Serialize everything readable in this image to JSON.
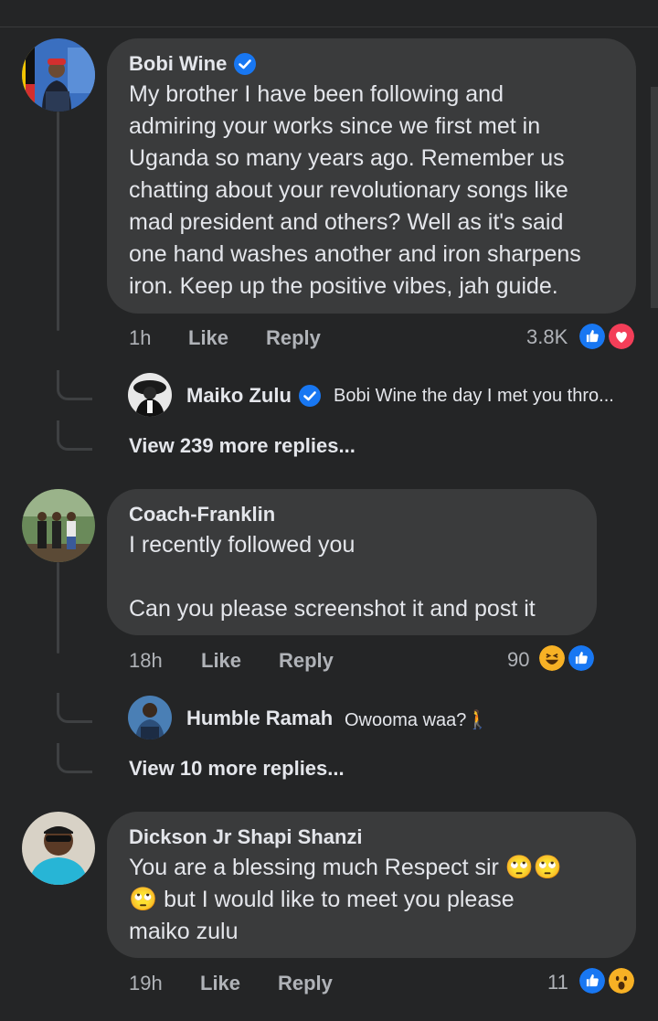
{
  "comments": [
    {
      "author": "Bobi Wine",
      "verified": true,
      "text_lines": [
        "My brother I have been following and",
        "admiring your works since we first met in",
        "Uganda so many years ago. Remember us",
        "chatting about your revolutionary songs like",
        "mad president and others? Well as it's said",
        "one hand washes another and iron sharpens",
        "iron. Keep up the positive vibes, jah guide."
      ],
      "time": "1h",
      "like_label": "Like",
      "reply_label": "Reply",
      "reaction_count": "3.8K",
      "reactions": [
        "like",
        "love"
      ],
      "reply": {
        "author": "Maiko Zulu",
        "verified": true,
        "text": "Bobi Wine the day I met you thro..."
      },
      "view_more": "View 239 more replies..."
    },
    {
      "author": "Coach-Franklin",
      "verified": false,
      "text_lines": [
        "I recently followed you",
        "",
        "Can you please screenshot it and post it"
      ],
      "time": "18h",
      "like_label": "Like",
      "reply_label": "Reply",
      "reaction_count": "90",
      "reactions": [
        "haha",
        "like"
      ],
      "reply": {
        "author": "Humble Ramah",
        "verified": false,
        "text": "Owooma waa?🚶"
      },
      "view_more": "View 10 more replies..."
    },
    {
      "author": "Dickson Jr Shapi Shanzi",
      "verified": false,
      "text_lines": [
        "You are a blessing much Respect sir 🙄🙄",
        "🙄 but I would like to meet you please",
        "maiko zulu"
      ],
      "time": "19h",
      "like_label": "Like",
      "reply_label": "Reply",
      "reaction_count": "11",
      "reactions": [
        "like",
        "wow"
      ]
    }
  ],
  "colors": {
    "background": "#242526",
    "bubble": "#3a3b3c",
    "text": "#e4e6eb",
    "meta": "#b0b3b8",
    "verified": "#1877f2",
    "like": "#1877f2",
    "love": "#f33e58",
    "haha": "#f7b125"
  }
}
